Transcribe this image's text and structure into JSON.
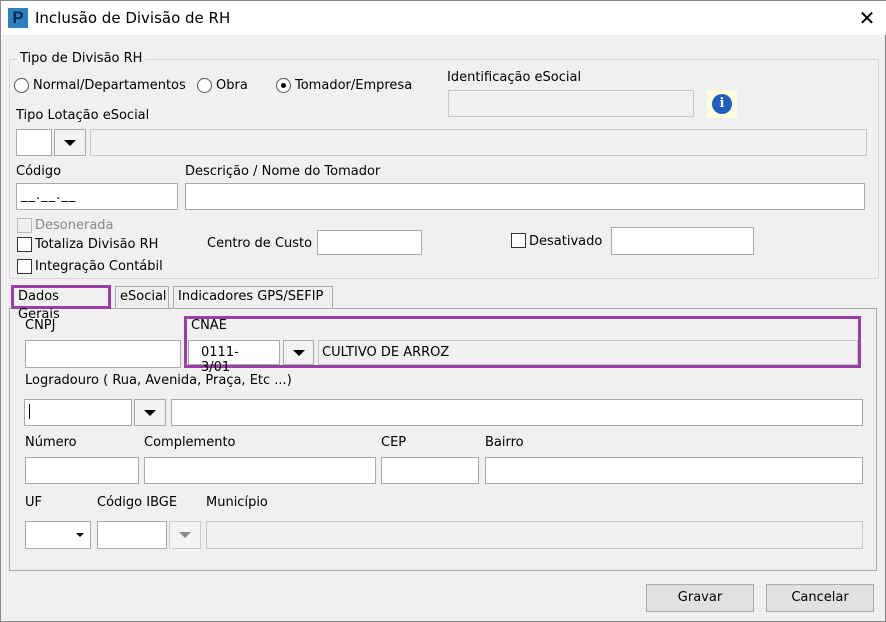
{
  "window": {
    "title": "Inclusão de Divisão de RH",
    "close": "✕",
    "logo": "P"
  },
  "tipo_divisao": {
    "legend": "Tipo de Divisão RH",
    "options": [
      "Normal/Departamentos",
      "Obra",
      "Tomador/Empresa"
    ],
    "selected": "Tomador/Empresa"
  },
  "identificacao": {
    "label": "Identificação eSocial",
    "value": "",
    "info_icon": "i"
  },
  "tipo_lotacao": {
    "label": "Tipo Lotação eSocial",
    "code": "",
    "desc": ""
  },
  "codigo": {
    "label": "Código",
    "value": "__.__.__"
  },
  "descricao": {
    "label": "Descrição / Nome do Tomador",
    "value": ""
  },
  "checks": {
    "desonerada": "Desonerada",
    "totaliza": "Totaliza Divisão RH",
    "integracao": "Integração Contábil",
    "desativado": "Desativado"
  },
  "centro_custo": {
    "label": "Centro de Custo",
    "value": ""
  },
  "tabs": [
    "Dados Gerais",
    "eSocial",
    "Indicadores GPS/SEFIP"
  ],
  "dados": {
    "cnpj": {
      "label": "CNPJ",
      "value": ""
    },
    "cnae": {
      "label": "CNAE",
      "code": "0111-3/01",
      "desc": "CULTIVO DE ARROZ"
    },
    "logradouro": {
      "label": "Logradouro ( Rua, Avenida, Praça, Etc ...)"
    },
    "numero": "Número",
    "complemento": "Complemento",
    "cep": "CEP",
    "bairro": "Bairro",
    "uf": "UF",
    "codigo_ibge": "Código IBGE",
    "municipio": "Município"
  },
  "buttons": {
    "save": "Gravar",
    "cancel": "Cancelar"
  }
}
